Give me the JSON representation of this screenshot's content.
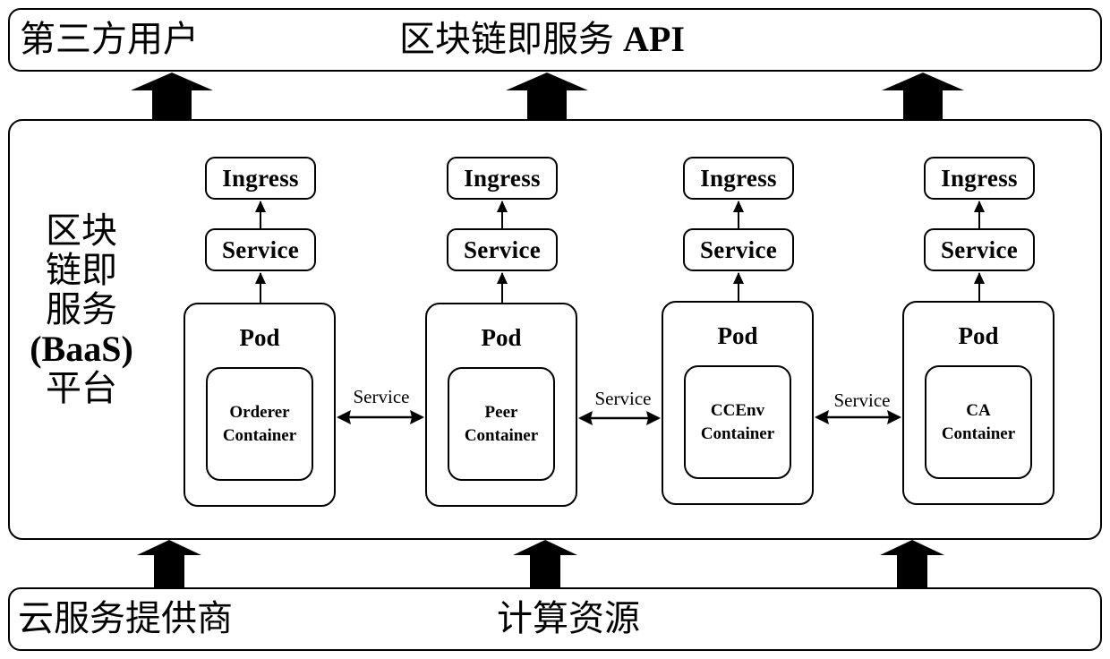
{
  "top_bar": {
    "left_label": "第三方用户",
    "center_label_cn": "区块链即服务",
    "center_label_en": "API"
  },
  "platform": {
    "side_label_lines": [
      "区块",
      "链即",
      "服务",
      "(BaaS)",
      "平台"
    ]
  },
  "pods": [
    {
      "ingress": "Ingress",
      "service": "Service",
      "title": "Pod",
      "container_line1": "Orderer",
      "container_line2": "Container"
    },
    {
      "ingress": "Ingress",
      "service": "Service",
      "title": "Pod",
      "container_line1": "Peer",
      "container_line2": "Container"
    },
    {
      "ingress": "Ingress",
      "service": "Service",
      "title": "Pod",
      "container_line1": "CCEnv",
      "container_line2": "Container"
    },
    {
      "ingress": "Ingress",
      "service": "Service",
      "title": "Pod",
      "container_line1": "CA",
      "container_line2": "Container"
    }
  ],
  "pod_links": [
    "Service",
    "Service",
    "Service"
  ],
  "bottom_bar": {
    "left_label": "云服务提供商",
    "center_label": "计算资源"
  },
  "colors": {
    "stroke": "#000000",
    "background": "#ffffff"
  }
}
